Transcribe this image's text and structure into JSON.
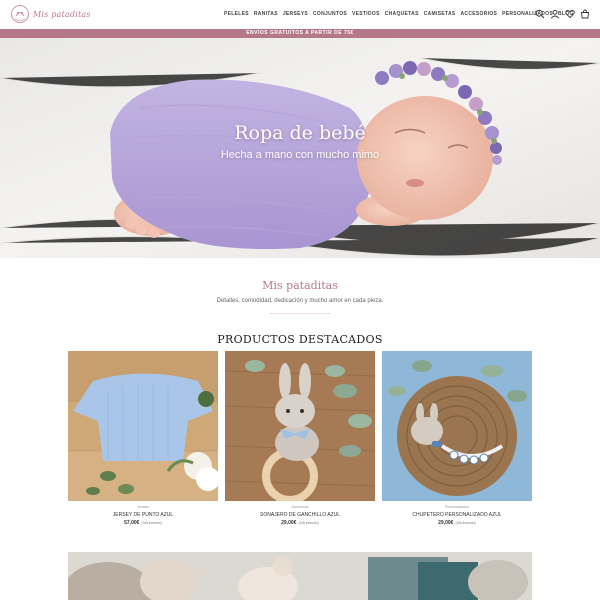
{
  "header": {
    "logo_text": "Mis pataditas",
    "nav": [
      "PELELES",
      "RANITAS",
      "JERSEYS",
      "CONJUNTOS",
      "VESTIDOS",
      "CHAQUETAS",
      "CAMISETAS",
      "ACCESORIOS",
      "PERSONALIZADOS",
      "BLOG"
    ],
    "icons": [
      "search-icon",
      "user-icon",
      "heart-icon",
      "cart-icon"
    ]
  },
  "promo": {
    "text": "ENVÍOS GRATUITOS A PARTIR DE 75€"
  },
  "hero": {
    "title": "Ropa de bebé",
    "subtitle": "Hecha a mano con mucho mimo"
  },
  "intro": {
    "title": "Mis pataditas",
    "text": "Detalles, comodidad, dedicación y mucho amor en cada pieza."
  },
  "featured": {
    "title": "PRODUCTOS DESTACADOS",
    "products": [
      {
        "category": "Jerseys",
        "name": "JERSEY DE PUNTO AZUL",
        "price": "57,00€",
        "vat": "(IVA incluido)"
      },
      {
        "category": "Accesorios",
        "name": "SONAJERO DE GANCHILLO AZUL",
        "price": "29,00€",
        "vat": "(IVA incluido)"
      },
      {
        "category": "Personalizados",
        "name": "CHUPETERO PERSONALIZADO AZUL",
        "price": "29,00€",
        "vat": "(IVA incluido)"
      }
    ]
  },
  "colors": {
    "accent": "#b5788a",
    "promo_bg": "#b5788a",
    "text_dark": "#222222"
  }
}
